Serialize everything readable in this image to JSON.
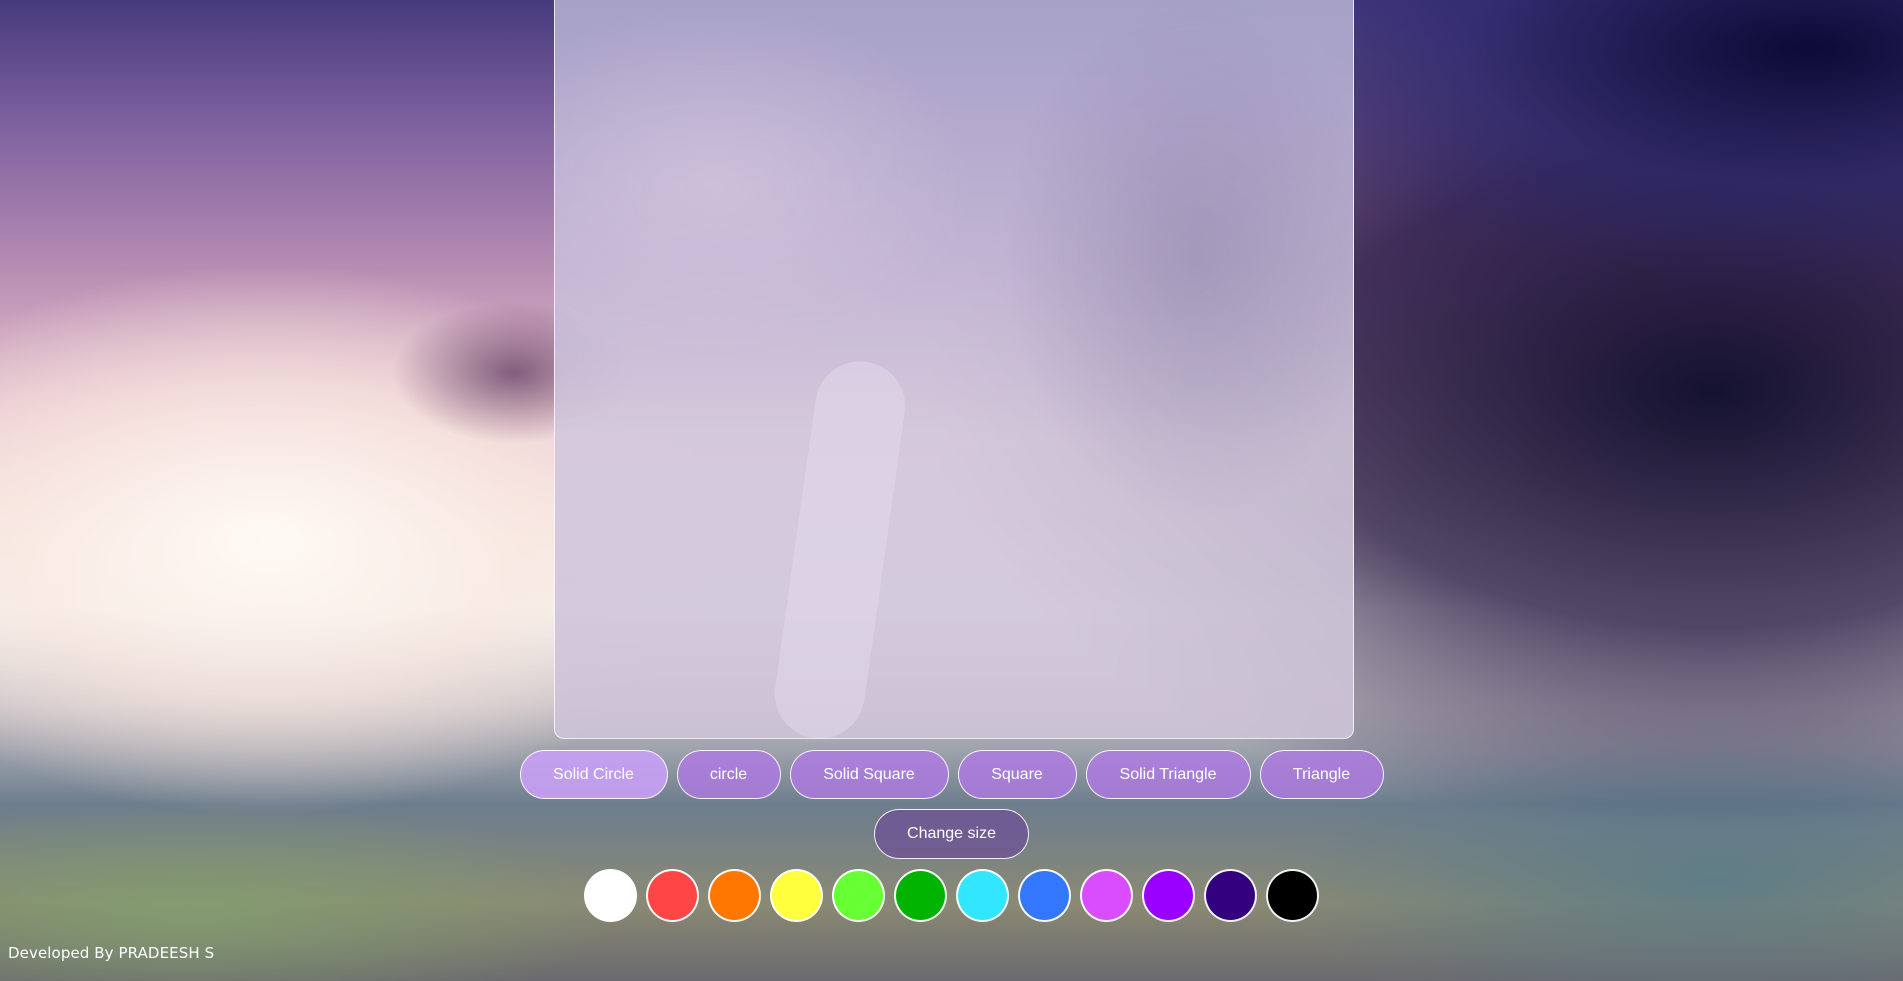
{
  "shapes": {
    "buttons": [
      {
        "label": "Solid Circle"
      },
      {
        "label": "circle"
      },
      {
        "label": "Solid Square"
      },
      {
        "label": "Square"
      },
      {
        "label": "Solid Triangle"
      },
      {
        "label": "Triangle"
      }
    ],
    "active": "Solid Circle"
  },
  "size": {
    "label": "Change size"
  },
  "palette": {
    "colors": [
      {
        "name": "white",
        "hex": "#ffffff"
      },
      {
        "name": "red",
        "hex": "#ff4545"
      },
      {
        "name": "orange",
        "hex": "#ff7700"
      },
      {
        "name": "yellow",
        "hex": "#ffff3d"
      },
      {
        "name": "light-green",
        "hex": "#66ff33"
      },
      {
        "name": "green",
        "hex": "#00b300"
      },
      {
        "name": "cyan",
        "hex": "#33e6ff"
      },
      {
        "name": "blue",
        "hex": "#3377ff"
      },
      {
        "name": "magenta",
        "hex": "#d94dff"
      },
      {
        "name": "purple",
        "hex": "#9900ff"
      },
      {
        "name": "indigo",
        "hex": "#330080"
      },
      {
        "name": "black",
        "hex": "#000000"
      }
    ]
  },
  "footer": {
    "credit": "Developed By PRADEESH S"
  }
}
